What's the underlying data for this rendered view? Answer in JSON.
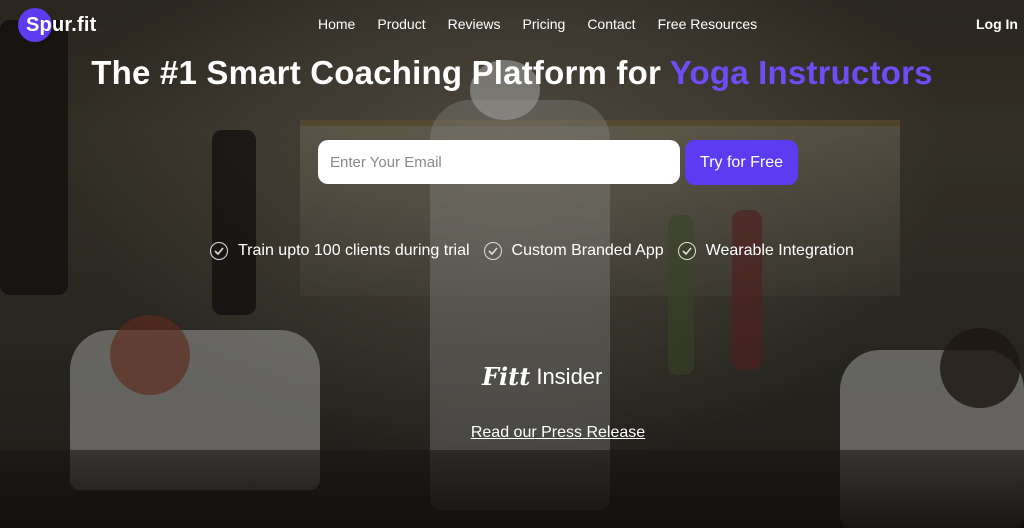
{
  "brand": {
    "name": "Spur.fit",
    "accent": "#5b3cf0"
  },
  "nav": {
    "links": [
      "Home",
      "Product",
      "Reviews",
      "Pricing",
      "Contact",
      "Free Resources"
    ],
    "login": "Log In"
  },
  "hero": {
    "headline_prefix": "The #1 Smart Coaching Platform for",
    "headline_accent": "Yoga Instructors",
    "headline_accent_color": "#6f4cf6"
  },
  "signup": {
    "email_placeholder": "Enter Your Email",
    "email_value": "",
    "cta": "Try for Free"
  },
  "features": [
    {
      "icon": "check-circle-icon",
      "text": "Train upto 100 clients during trial"
    },
    {
      "icon": "check-circle-icon",
      "text": "Custom Branded App"
    },
    {
      "icon": "check-circle-icon",
      "text": "Wearable Integration"
    }
  ],
  "press": {
    "logo_part1": "Fitt",
    "logo_part2": "Insider",
    "link_text": "Read our Press Release"
  }
}
